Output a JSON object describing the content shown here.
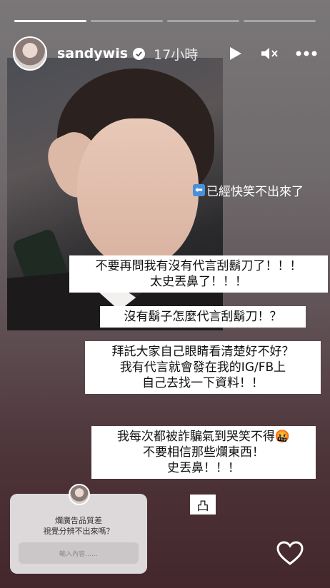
{
  "story": {
    "progress_total": 4,
    "progress_done": 1,
    "username": "sandywis",
    "time": "17小時",
    "captions": {
      "arrow_note": "已經快笑不出來了",
      "line1a": "不要再問我有沒有代言刮鬍刀了！！！",
      "line1b": "太史丟鼻了！！！",
      "line2": "沒有鬍子怎麼代言刮鬍刀！？",
      "line3a": "拜託大家自己眼睛看清楚好不好？",
      "line3b": "我有代言就會發在我的IG/FB上",
      "line3c": "自己去找一下資料！！",
      "line4a": "我每次都被詐騙氣到哭笑不得🤬",
      "line4b": "不要相信那些爛東西！",
      "line4c": "史丟鼻！！！"
    },
    "sticker_text": "凸",
    "question": {
      "line1": "爛廣告品質差",
      "line2": "視覺分辨不出來嗎？",
      "placeholder": "輸入內容……"
    }
  },
  "icons": {
    "verified": "verified-badge-icon",
    "play": "play-icon",
    "mute": "mute-icon",
    "more": "more-icon",
    "heart": "heart-icon"
  }
}
